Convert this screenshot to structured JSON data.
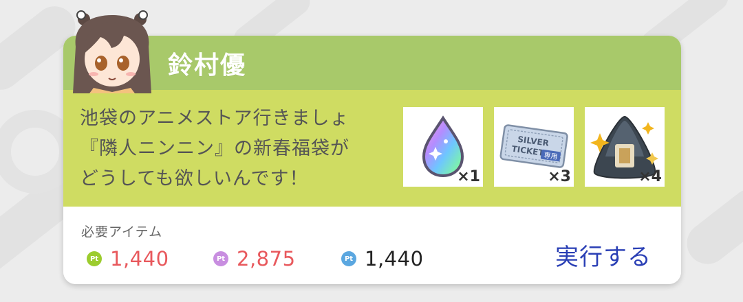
{
  "character": {
    "name": "鈴村優"
  },
  "message": {
    "lines": [
      "池袋のアニメストア行きましょ",
      "『隣人ニンニン』の新春福袋が",
      "どうしても欲しいんです！"
    ]
  },
  "rewards": [
    {
      "icon": "rainbow-drop-icon",
      "qty": "×1"
    },
    {
      "icon": "silver-ticket-icon",
      "ticket_text_1": "SILVER",
      "ticket_text_2": "TICKET",
      "ticket_badge": "専用",
      "qty": "×3"
    },
    {
      "icon": "onigiri-icon",
      "qty": "×4"
    }
  ],
  "requirements": {
    "label": "必要アイテム",
    "costs": [
      {
        "icon_text": "Pt",
        "value": "1,440",
        "icon_color": "#9ccc2e",
        "value_color": "#e8585c"
      },
      {
        "icon_text": "Pt",
        "value": "2,875",
        "icon_color": "#c88ee0",
        "value_color": "#e8585c"
      },
      {
        "icon_text": "Pt",
        "value": "1,440",
        "icon_color": "#5ba7e0",
        "value_color": "#222222"
      }
    ]
  },
  "action": {
    "execute_label": "実行する"
  },
  "colors": {
    "header": "#a8c96a",
    "body": "#cfdc62",
    "button_text": "#2a3fb5"
  }
}
